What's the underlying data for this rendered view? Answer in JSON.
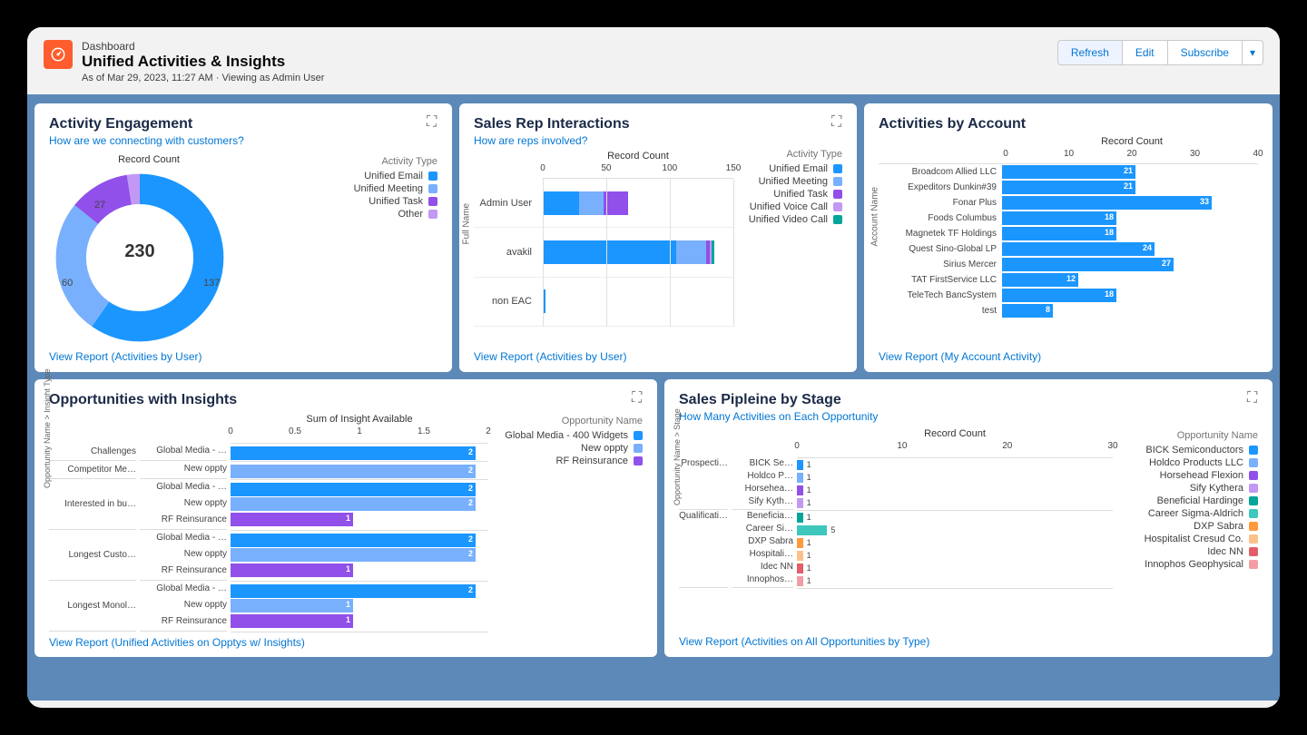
{
  "header": {
    "label": "Dashboard",
    "title": "Unified Activities & Insights",
    "meta": "As of Mar 29, 2023, 11:27 AM · Viewing as Admin User",
    "actions": {
      "refresh": "Refresh",
      "edit": "Edit",
      "subscribe": "Subscribe"
    }
  },
  "panel1": {
    "title": "Activity Engagement",
    "sub": "How are we connecting with customers?",
    "chartHeader": "Record Count",
    "center": "230",
    "legendTitle": "Activity Type",
    "legend": [
      {
        "label": "Unified Email",
        "color": "#1b96ff"
      },
      {
        "label": "Unified Meeting",
        "color": "#78b0fd"
      },
      {
        "label": "Unified Task",
        "color": "#9050e9"
      },
      {
        "label": "Other",
        "color": "#c398f5"
      }
    ],
    "labels": {
      "a": "137",
      "b": "60",
      "c": "27"
    },
    "footer": "View Report (Activities by User)"
  },
  "panel2": {
    "title": "Sales Rep Interactions",
    "sub": "How are reps involved?",
    "chartHeader": "Record Count",
    "yaxisTitle": "Full Name",
    "xticks": [
      "0",
      "50",
      "100",
      "150"
    ],
    "legendTitle": "Activity Type",
    "legend": [
      {
        "label": "Unified Email",
        "color": "#1b96ff"
      },
      {
        "label": "Unified Meeting",
        "color": "#78b0fd"
      },
      {
        "label": "Unified Task",
        "color": "#9050e9"
      },
      {
        "label": "Unified Voice Call",
        "color": "#c398f5"
      },
      {
        "label": "Unified Video Call",
        "color": "#06a59a"
      }
    ],
    "rows": [
      "Admin User",
      "avakil",
      "non EAC"
    ],
    "footer": "View Report (Activities by User)"
  },
  "panel3": {
    "title": "Activities by Account",
    "chartHeader": "Record Count",
    "yaxisTitle": "Account Name",
    "xticks": [
      "0",
      "10",
      "20",
      "30",
      "40"
    ],
    "footer": "View Report (My Account Activity)"
  },
  "panel4": {
    "title": "Opportunities with Insights",
    "chartHeader": "Sum of Insight Available",
    "yaxisTitle": "Opportunity Name > Insight Type",
    "xticks": [
      "0",
      "0.5",
      "1",
      "1.5",
      "2"
    ],
    "legendTitle": "Opportunity Name",
    "legend": [
      {
        "label": "Global Media - 400 Widgets",
        "color": "#1b96ff"
      },
      {
        "label": "New oppty",
        "color": "#78b0fd"
      },
      {
        "label": "RF Reinsurance",
        "color": "#9050e9"
      }
    ],
    "footer": "View Report (Unified Activities on Opptys w/ Insights)"
  },
  "panel5": {
    "title": "Sales Pipleine by Stage",
    "sub": "How Many Activities on Each Opportunity",
    "chartHeader": "Record Count",
    "yaxisTitle": "Opportunity Name > Stage",
    "xticks": [
      "0",
      "10",
      "20",
      "30"
    ],
    "legendTitle": "Opportunity Name",
    "legend": [
      {
        "label": "BICK Semiconductors",
        "color": "#1b96ff"
      },
      {
        "label": "Holdco Products LLC",
        "color": "#78b0fd"
      },
      {
        "label": "Horsehead Flexion",
        "color": "#9050e9"
      },
      {
        "label": "Sify Kythera",
        "color": "#c398f5"
      },
      {
        "label": "Beneficial Hardinge",
        "color": "#06a59a"
      },
      {
        "label": "Career Sigma-Aldrich",
        "color": "#3ec7bc"
      },
      {
        "label": "DXP Sabra",
        "color": "#ff9a3c"
      },
      {
        "label": "Hospitalist Cresud Co.",
        "color": "#fcc18b"
      },
      {
        "label": "Idec NN",
        "color": "#e25e68"
      },
      {
        "label": "Innophos Geophysical",
        "color": "#f29da3"
      }
    ],
    "footer": "View Report (Activities on All Opportunities by Type)"
  },
  "chart_data": [
    {
      "id": "activity_engagement",
      "type": "pie",
      "title": "Record Count",
      "total": 230,
      "series": [
        {
          "name": "Unified Email",
          "value": 137
        },
        {
          "name": "Unified Meeting",
          "value": 60
        },
        {
          "name": "Unified Task",
          "value": 27
        },
        {
          "name": "Other",
          "value": 6
        }
      ]
    },
    {
      "id": "sales_rep_interactions",
      "type": "bar",
      "orientation": "horizontal",
      "stacked": true,
      "xlabel": "Record Count",
      "ylabel": "Full Name",
      "xlim": [
        0,
        150
      ],
      "categories": [
        "Admin User",
        "avakil",
        "non EAC"
      ],
      "series": [
        {
          "name": "Unified Email",
          "values": [
            30,
            110,
            2
          ]
        },
        {
          "name": "Unified Meeting",
          "values": [
            20,
            25,
            0
          ]
        },
        {
          "name": "Unified Task",
          "values": [
            20,
            3,
            0
          ]
        },
        {
          "name": "Unified Voice Call",
          "values": [
            0,
            1,
            0
          ]
        },
        {
          "name": "Unified Video Call",
          "values": [
            0,
            2,
            0
          ]
        }
      ]
    },
    {
      "id": "activities_by_account",
      "type": "bar",
      "orientation": "horizontal",
      "xlabel": "Record Count",
      "ylabel": "Account Name",
      "xlim": [
        0,
        40
      ],
      "categories": [
        "Broadcom Allied LLC",
        "Expeditors Dunkin#39",
        "Fonar Plus",
        "Foods Columbus",
        "Magnetek TF Holdings",
        "Quest Sino-Global LP",
        "Sirius Mercer",
        "TAT FirstService LLC",
        "TeleTech BancSystem",
        "test"
      ],
      "values": [
        21,
        21,
        33,
        18,
        18,
        24,
        27,
        12,
        18,
        8
      ]
    },
    {
      "id": "opportunities_with_insights",
      "type": "bar",
      "orientation": "horizontal",
      "grouped_by": "Insight Type",
      "xlabel": "Sum of Insight Available",
      "ylabel": "Opportunity Name > Insight Type",
      "xlim": [
        0,
        2
      ],
      "groups": [
        {
          "insight_type": "Challenges",
          "rows": [
            {
              "opportunity": "Global Media - …",
              "value": 2,
              "color": "#1b96ff"
            }
          ]
        },
        {
          "insight_type": "Competitor Me…",
          "rows": [
            {
              "opportunity": "New oppty",
              "value": 2,
              "color": "#78b0fd"
            }
          ]
        },
        {
          "insight_type": "Interested in bu…",
          "rows": [
            {
              "opportunity": "Global Media - …",
              "value": 2,
              "color": "#1b96ff"
            },
            {
              "opportunity": "New oppty",
              "value": 2,
              "color": "#78b0fd"
            },
            {
              "opportunity": "RF Reinsurance",
              "value": 1,
              "color": "#9050e9"
            }
          ]
        },
        {
          "insight_type": "Longest Custo…",
          "rows": [
            {
              "opportunity": "Global Media - …",
              "value": 2,
              "color": "#1b96ff"
            },
            {
              "opportunity": "New oppty",
              "value": 2,
              "color": "#78b0fd"
            },
            {
              "opportunity": "RF Reinsurance",
              "value": 1,
              "color": "#9050e9"
            }
          ]
        },
        {
          "insight_type": "Longest Monol…",
          "rows": [
            {
              "opportunity": "Global Media - …",
              "value": 2,
              "color": "#1b96ff"
            },
            {
              "opportunity": "New oppty",
              "value": 1,
              "color": "#78b0fd"
            },
            {
              "opportunity": "RF Reinsurance",
              "value": 1,
              "color": "#9050e9"
            }
          ]
        }
      ]
    },
    {
      "id": "sales_pipeline_by_stage",
      "type": "bar",
      "orientation": "horizontal",
      "grouped_by": "Stage",
      "xlabel": "Record Count",
      "ylabel": "Opportunity Name > Stage",
      "xlim": [
        0,
        30
      ],
      "groups": [
        {
          "stage": "Prospecti…",
          "rows": [
            {
              "opportunity": "BICK Se…",
              "value": 1,
              "color": "#1b96ff"
            },
            {
              "opportunity": "Holdco P…",
              "value": 1,
              "color": "#78b0fd"
            },
            {
              "opportunity": "Horsehea…",
              "value": 1,
              "color": "#9050e9"
            },
            {
              "opportunity": "Sify Kyth…",
              "value": 1,
              "color": "#c398f5"
            }
          ]
        },
        {
          "stage": "Qualificati…",
          "rows": [
            {
              "opportunity": "Beneficia…",
              "value": 1,
              "color": "#06a59a"
            },
            {
              "opportunity": "Career Si…",
              "value": 5,
              "color": "#3ec7bc"
            },
            {
              "opportunity": "DXP Sabra",
              "value": 1,
              "color": "#ff9a3c"
            },
            {
              "opportunity": "Hospitali…",
              "value": 1,
              "color": "#fcc18b"
            },
            {
              "opportunity": "Idec NN",
              "value": 1,
              "color": "#e25e68"
            },
            {
              "opportunity": "Innophos…",
              "value": 1,
              "color": "#f29da3"
            }
          ]
        }
      ]
    }
  ]
}
